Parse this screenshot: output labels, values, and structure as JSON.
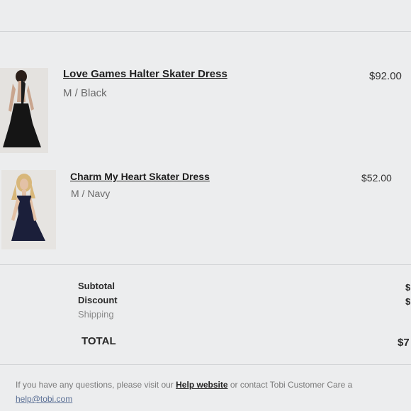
{
  "items": [
    {
      "title": "Love Games Halter Skater Dress",
      "variant": "M / Black",
      "price": "$92.00"
    },
    {
      "title": "Charm My Heart Skater Dress",
      "variant": "M / Navy",
      "price": "$52.00"
    }
  ],
  "summary": {
    "subtotal_label": "Subtotal",
    "subtotal_value": "$",
    "discount_label": "Discount",
    "discount_value": "$",
    "shipping_label": "Shipping",
    "total_label": "TOTAL",
    "total_value": "$7"
  },
  "footer": {
    "text_before": "If you have any questions, please visit our ",
    "help_link": "Help website",
    "text_middle": " or contact Tobi Customer Care a",
    "email": "help@tobi.com"
  },
  "colors": {
    "background": "#ecedee",
    "link": "#5a6f95"
  }
}
